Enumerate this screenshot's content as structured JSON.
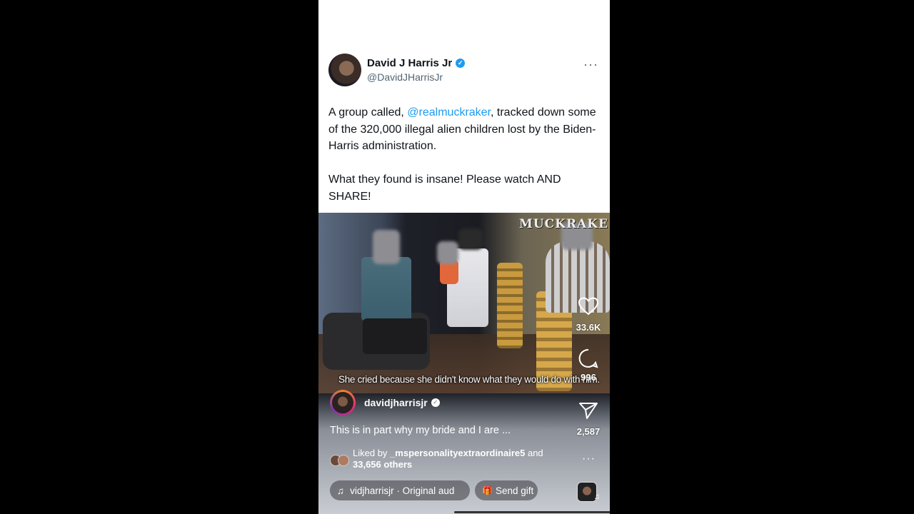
{
  "tweet": {
    "display_name": "David J Harris Jr",
    "verified_glyph": "✓",
    "handle": "@DavidJHarrisJr",
    "more_glyph": "···",
    "text_before_mention": "A group called, ",
    "mention": "@realmuckraker",
    "text_after_mention": ", tracked down some of the 320,000 illegal alien children lost by the Biden-Harris administration.",
    "text_second_paragraph": "What they found is insane! Please watch AND SHARE!"
  },
  "video": {
    "watermark": "MUCKRAKE",
    "caption": "She cried because she didn't know what they would do with him."
  },
  "actions": {
    "like_icon": "heart-icon",
    "like_count": "33.6K",
    "comment_icon": "comment-icon",
    "comment_count": "996",
    "share_icon": "send-icon",
    "share_count": "2,587",
    "more_glyph": "···"
  },
  "instagram": {
    "username": "davidjharrisjr",
    "verified_glyph": "✓",
    "caption": "This is in part why my bride and I are ...",
    "liked_prefix": "Liked by ",
    "liked_user": "_mspersonalityextraordinaire5",
    "liked_suffix": " and",
    "liked_others": "33,656 others",
    "audio_glyph": "♫",
    "audio_label": "vidjharrisjr · Original aud",
    "gift_glyph": "🎁",
    "gift_label": "Send gift",
    "audio_note_glyph": "♫"
  },
  "colors": {
    "twitter_blue": "#1d9bf0",
    "text_dark": "#0f1419",
    "text_muted": "#536471"
  }
}
